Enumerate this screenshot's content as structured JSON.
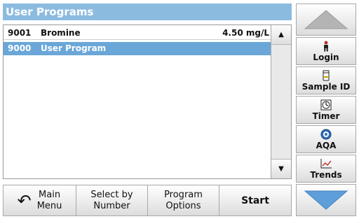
{
  "header": {
    "title": "User Programs"
  },
  "programs": [
    {
      "number": "9001",
      "name": "Bromine",
      "value": "4.50 mg/L",
      "selected": false
    },
    {
      "number": "9000",
      "name": "User Program",
      "value": "",
      "selected": true
    }
  ],
  "scroll": {
    "up_icon": "triangle-up-icon",
    "down_icon": "triangle-down-icon"
  },
  "bottom_bar": {
    "main_menu": {
      "line1": "Main",
      "line2": "Menu",
      "icon": "back-arrow-icon"
    },
    "select_by_number": {
      "line1": "Select by",
      "line2": "Number"
    },
    "program_options": {
      "line1": "Program",
      "line2": "Options"
    },
    "start": {
      "label": "Start"
    }
  },
  "side_panel": {
    "page_up_icon": "large-up-arrow-icon",
    "page_down_icon": "large-down-arrow-icon",
    "login": {
      "label": "Login",
      "icon": "person-icon"
    },
    "sample_id": {
      "label": "Sample ID",
      "icon": "sample-container-icon"
    },
    "timer": {
      "label": "Timer",
      "icon": "timer-icon"
    },
    "aqa": {
      "label": "AQA",
      "icon": "aqa-icon"
    },
    "trends": {
      "label": "Trends",
      "icon": "trend-chart-icon"
    }
  },
  "colors": {
    "title_bar": "#8cbbe0",
    "selected_row": "#6aa7d8",
    "nav_arrow": "#5e9fda",
    "nav_arrow_disabled": "#b4b4b4"
  }
}
